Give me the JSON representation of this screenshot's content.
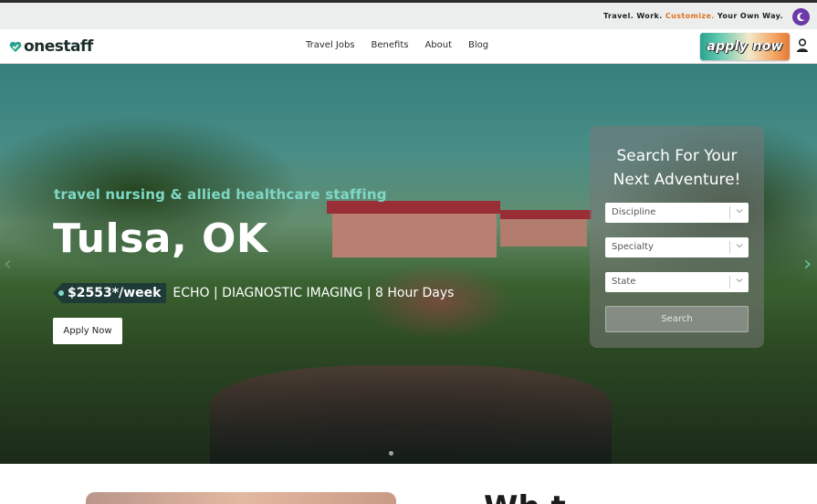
{
  "topbar": {
    "tagline_parts": [
      "Travel. Work. ",
      "Customize.",
      " Your Own Way."
    ],
    "theme_icon": "moon-icon",
    "accent_color": "#e0701e"
  },
  "nav": {
    "logo_text": "onestaff",
    "logo_icon": "heart-check-icon",
    "links": [
      "Travel Jobs",
      "Benefits",
      "About",
      "Blog"
    ],
    "apply_now_label": "apply now",
    "user_icon": "user-icon"
  },
  "hero": {
    "subtitle": "travel nursing & allied healthcare staffing",
    "city": "Tulsa, OK",
    "pay": "$2553*/week",
    "job_desc": "ECHO  |  DIAGNOSTIC IMAGING  |  8 Hour Days",
    "apply_button": "Apply Now",
    "subtitle_color": "#7fd8c6"
  },
  "search": {
    "title_line1": "Search For Your",
    "title_line2": "Next Adventure!",
    "discipline_placeholder": "Discipline",
    "specialty_placeholder": "Specialty",
    "state_placeholder": "State",
    "button": "Search"
  },
  "below": {
    "heading_partial": "Wh t"
  }
}
